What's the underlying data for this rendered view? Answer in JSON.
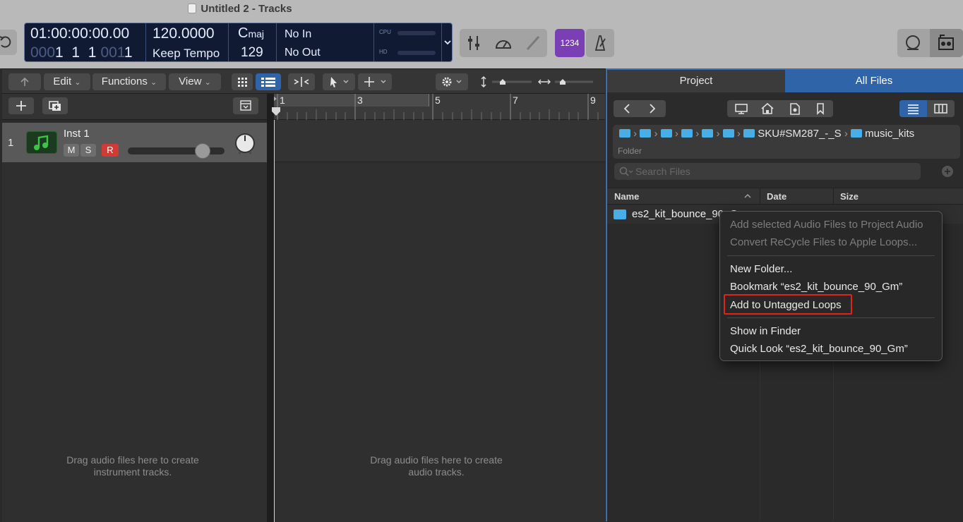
{
  "window": {
    "title": "Untitled 2 - Tracks"
  },
  "lcd": {
    "position_time": "01:00:00:00.00",
    "position_bars_dim1": "000",
    "position_bars": "1  1  1",
    "position_bars_dim2": "001",
    "position_bars_tick": "1",
    "tempo": "120.0000",
    "tempo_mode": "Keep Tempo",
    "key_note": "C",
    "key_mode": "maj",
    "signature": "129",
    "midi_in": "No In",
    "midi_out": "No Out",
    "cpu_label": "CPU",
    "hd_label": "HD"
  },
  "controlbar": {
    "count_in_label": "1234"
  },
  "toolbar": {
    "edit": "Edit",
    "functions": "Functions",
    "view": "View"
  },
  "tracks": [
    {
      "number": "1",
      "name": "Inst 1",
      "mute": "M",
      "solo": "S",
      "record": "R",
      "volume_level": 0.83
    }
  ],
  "ruler": {
    "bars": [
      "1",
      "3",
      "5",
      "7",
      "9"
    ]
  },
  "empty_hints": {
    "tracklist": "Drag audio files here to create instrument tracks.",
    "lane": "Drag audio files here to create audio tracks."
  },
  "browser": {
    "tabs": {
      "project": "Project",
      "all_files": "All Files"
    },
    "path": {
      "segment1": "SKU#SM287_-_S",
      "segment2": "music_kits",
      "kind": "Folder"
    },
    "search_placeholder": "Search Files",
    "columns": {
      "name": "Name",
      "date": "Date",
      "size": "Size"
    },
    "files": [
      {
        "name": "es2_kit_bounce_90_G"
      }
    ]
  },
  "context_menu": {
    "items": [
      {
        "label": "Add selected Audio Files to Project Audio",
        "enabled": false
      },
      {
        "label": "Convert ReCycle Files to Apple Loops...",
        "enabled": false
      },
      {
        "label": "New Folder...",
        "enabled": true
      },
      {
        "label": "Bookmark “es2_kit_bounce_90_Gm”",
        "enabled": true
      },
      {
        "label": "Add to Untagged Loops",
        "enabled": true,
        "highlight_color": "#e2231a"
      },
      {
        "label": "Show in Finder",
        "enabled": true
      },
      {
        "label": "Quick Look “es2_kit_bounce_90_Gm”",
        "enabled": true
      }
    ]
  },
  "colors": {
    "accent_blue": "#2f64a8",
    "record_red": "#d23b35",
    "count_in_purple": "#7b3fb5",
    "folder_blue": "#47aee6",
    "instrument_green": "#3cc447"
  }
}
